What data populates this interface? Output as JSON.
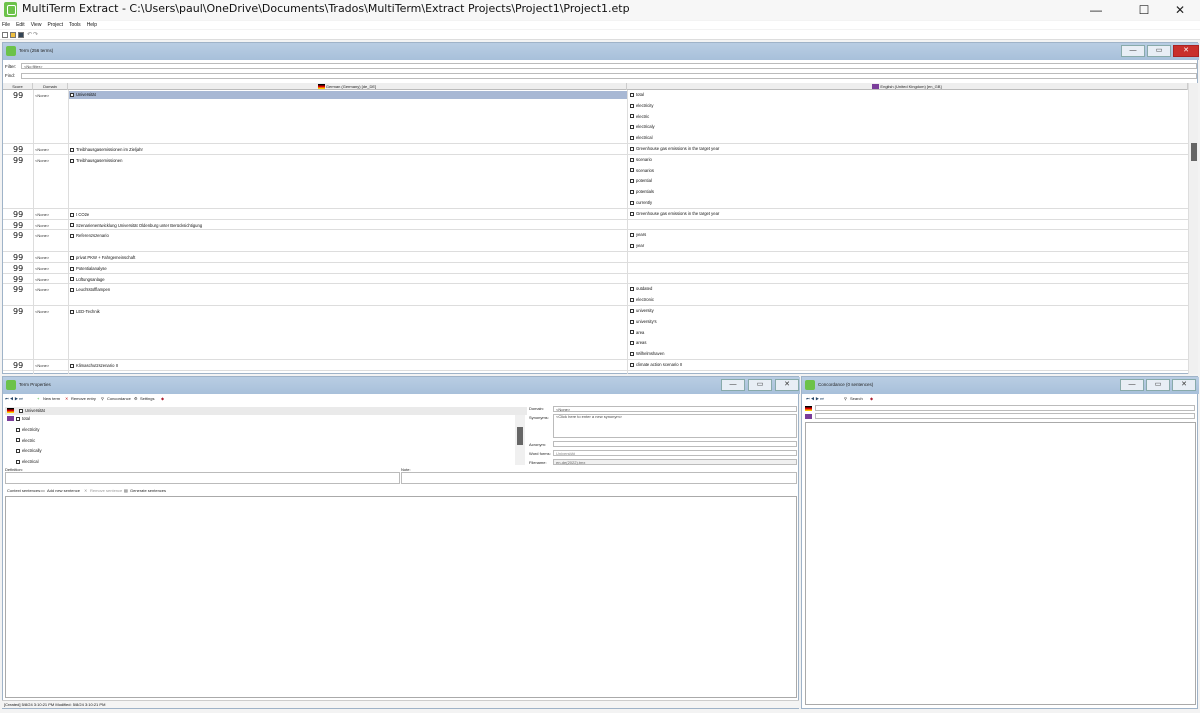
{
  "window": {
    "title": "MultiTerm Extract - C:\\Users\\paul\\OneDrive\\Documents\\Trados\\MultiTerm\\Extract Projects\\Project1\\Project1.etp",
    "minimize": "—",
    "maximize": "☐",
    "close": "✕"
  },
  "menu": [
    "File",
    "Edit",
    "View",
    "Project",
    "Tools",
    "Help"
  ],
  "term_panel": {
    "title": "Term (256 terms)",
    "filter_label": "Filter:",
    "filter_value": "<No filter>",
    "find_label": "Find:",
    "find_value": "",
    "columns": {
      "score": "Score",
      "domain": "Domain",
      "source": "German (Germany) [de_DE]",
      "target": "English (United Kingdom) [en_GB]"
    },
    "rows": [
      {
        "score": "99",
        "domain": "<None>",
        "source": "Universität",
        "targets": [
          "total",
          "electricity",
          "electric",
          "electricaly",
          "electrical"
        ]
      },
      {
        "score": "99",
        "domain": "<None>",
        "source": "Treibhausgasemissionen im Zieljahr",
        "targets": [
          "Greenhouse gas emissions in the target year"
        ]
      },
      {
        "score": "99",
        "domain": "<None>",
        "source": "Treibhausgasemissionen",
        "targets": [
          "scenario",
          "scenarios",
          "potential",
          "potentials",
          "currently"
        ]
      },
      {
        "score": "99",
        "domain": "<None>",
        "source": "t CO2e",
        "targets": [
          "Greenhouse gas emissions in the target year"
        ]
      },
      {
        "score": "99",
        "domain": "<None>",
        "source": "Szenarienentwicklung Universität Oldenburg unter Berücksichtigung",
        "targets": []
      },
      {
        "score": "99",
        "domain": "<None>",
        "source": "Referenzszenario",
        "targets": [
          "years",
          "year"
        ]
      },
      {
        "score": "99",
        "domain": "<None>",
        "source": "privat PKW + Fahrgemeinschaft",
        "targets": []
      },
      {
        "score": "99",
        "domain": "<None>",
        "source": "Potentialanalyse",
        "targets": []
      },
      {
        "score": "99",
        "domain": "<None>",
        "source": "Lüftungsanlage",
        "targets": []
      },
      {
        "score": "99",
        "domain": "<None>",
        "source": "Leuchtstofflampen",
        "targets": [
          "outdated",
          "electronic"
        ]
      },
      {
        "score": "99",
        "domain": "<None>",
        "source": "LED-Technik",
        "targets": [
          "university",
          "university's",
          "area",
          "areas",
          "Wilhelmshaven"
        ]
      },
      {
        "score": "99",
        "domain": "<None>",
        "source": "Klimaschutzszenario II",
        "targets": [
          "climate action scenario II"
        ]
      }
    ]
  },
  "properties_panel": {
    "title": "Term Properties",
    "toolbar": {
      "new_term": "New term",
      "remove_entry": "Remove entry",
      "concordance": "Concordance",
      "settings": "Settings"
    },
    "source_term": "Universität",
    "target_terms": [
      "total",
      "electricity",
      "electric",
      "electrically",
      "electrical"
    ],
    "domain_label": "Domain:",
    "domain_value": "<None>",
    "synonyms_label": "Synonyms:",
    "synonyms_value": "<Click here to enter a new synonym>",
    "acronym_label": "Acronym:",
    "wordforms_label": "Word forms:",
    "wordforms_value": "Universität",
    "filename_label": "Filename:",
    "filename_value": "en-de(2022).tmx",
    "definition_label": "Definition:",
    "note_label": "Note:",
    "context_toolbar": {
      "context_sentences": "Context sentences:",
      "add_new_sentence": "Add new sentence",
      "remove_sentence": "Remove sentence",
      "generate_sentences": "Generate sentences"
    },
    "status": "[Created] 5/8/24 3:10:21 PM   Modified: 5/8/24 3:10:21 PM"
  },
  "concordance_panel": {
    "title": "Concordance (0 sentences)",
    "search": "Search"
  }
}
